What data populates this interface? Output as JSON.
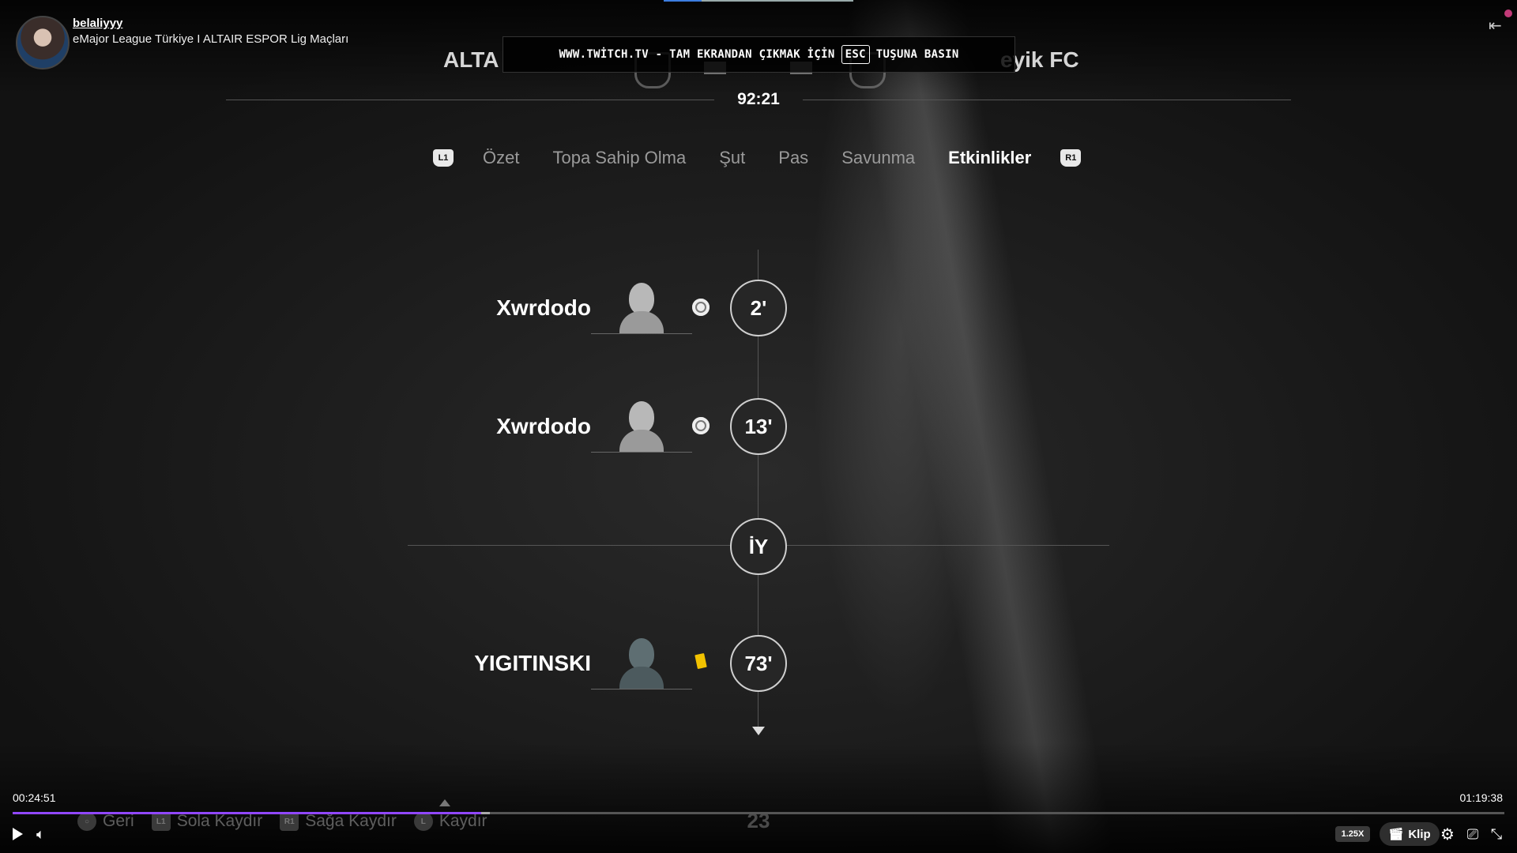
{
  "stream": {
    "channel": "belaliyyy",
    "title": "eMajor League Türkiye I ALTAIR ESPOR Lig Maçları"
  },
  "match": {
    "team_left": "ALTA",
    "team_right": "eyik FC",
    "clock": "92:21"
  },
  "banner": {
    "before": "WWW.TWİTCH.TV - TAM EKRANDAN ÇIKMAK İÇİN",
    "key": "ESC",
    "after": "TUŞUNA BASIN"
  },
  "tabs": {
    "left_button": "L1",
    "right_button": "R1",
    "items": [
      "Özet",
      "Topa Sahip Olma",
      "Şut",
      "Pas",
      "Savunma",
      "Etkinlikler"
    ],
    "active": "Etkinlikler"
  },
  "events": [
    {
      "player": "Xwrdodo",
      "minute": "2'",
      "type": "goal",
      "icon": "ball-icon"
    },
    {
      "player": "Xwrdodo",
      "minute": "13'",
      "type": "goal",
      "icon": "ball-icon"
    },
    {
      "player": "YIGITINSKI",
      "minute": "73'",
      "type": "yellow-card",
      "icon": "yellow-card-icon"
    }
  ],
  "half_marker": "İY",
  "hints": [
    {
      "button": "○",
      "label": "Geri"
    },
    {
      "button": "L1",
      "label": "Sola Kaydır"
    },
    {
      "button": "R1",
      "label": "Sağa Kaydır"
    },
    {
      "button": "L",
      "label": "Kaydır"
    }
  ],
  "page_number": "23",
  "player": {
    "current_time": "00:24:51",
    "total_time": "01:19:38",
    "progress": 0.314,
    "buffered": 0.32,
    "speed": "1.25X",
    "clip_label": "Klip"
  },
  "colors": {
    "accent": "#9147ff",
    "yellow_card": "#f2c200"
  }
}
